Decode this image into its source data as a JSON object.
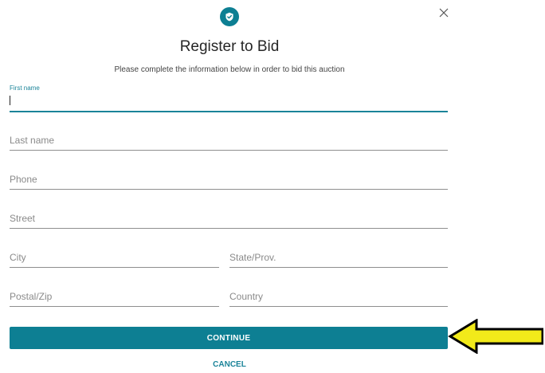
{
  "dialog": {
    "title": "Register to Bid",
    "subtitle": "Please complete the information below in order to bid this auction",
    "badge_icon": "shield-check-icon",
    "close_icon": "close-icon"
  },
  "form": {
    "first_name": {
      "label": "First name",
      "value": ""
    },
    "last_name": {
      "placeholder": "Last name",
      "value": ""
    },
    "phone": {
      "placeholder": "Phone",
      "value": ""
    },
    "street": {
      "placeholder": "Street",
      "value": ""
    },
    "city": {
      "placeholder": "City",
      "value": ""
    },
    "state": {
      "placeholder": "State/Prov.",
      "value": ""
    },
    "postal": {
      "placeholder": "Postal/Zip",
      "value": ""
    },
    "country": {
      "placeholder": "Country",
      "value": ""
    }
  },
  "actions": {
    "continue_label": "CONTINUE",
    "cancel_label": "CANCEL"
  },
  "colors": {
    "accent": "#0d7f93",
    "arrow_fill": "#f2ea1a",
    "arrow_stroke": "#000000"
  }
}
